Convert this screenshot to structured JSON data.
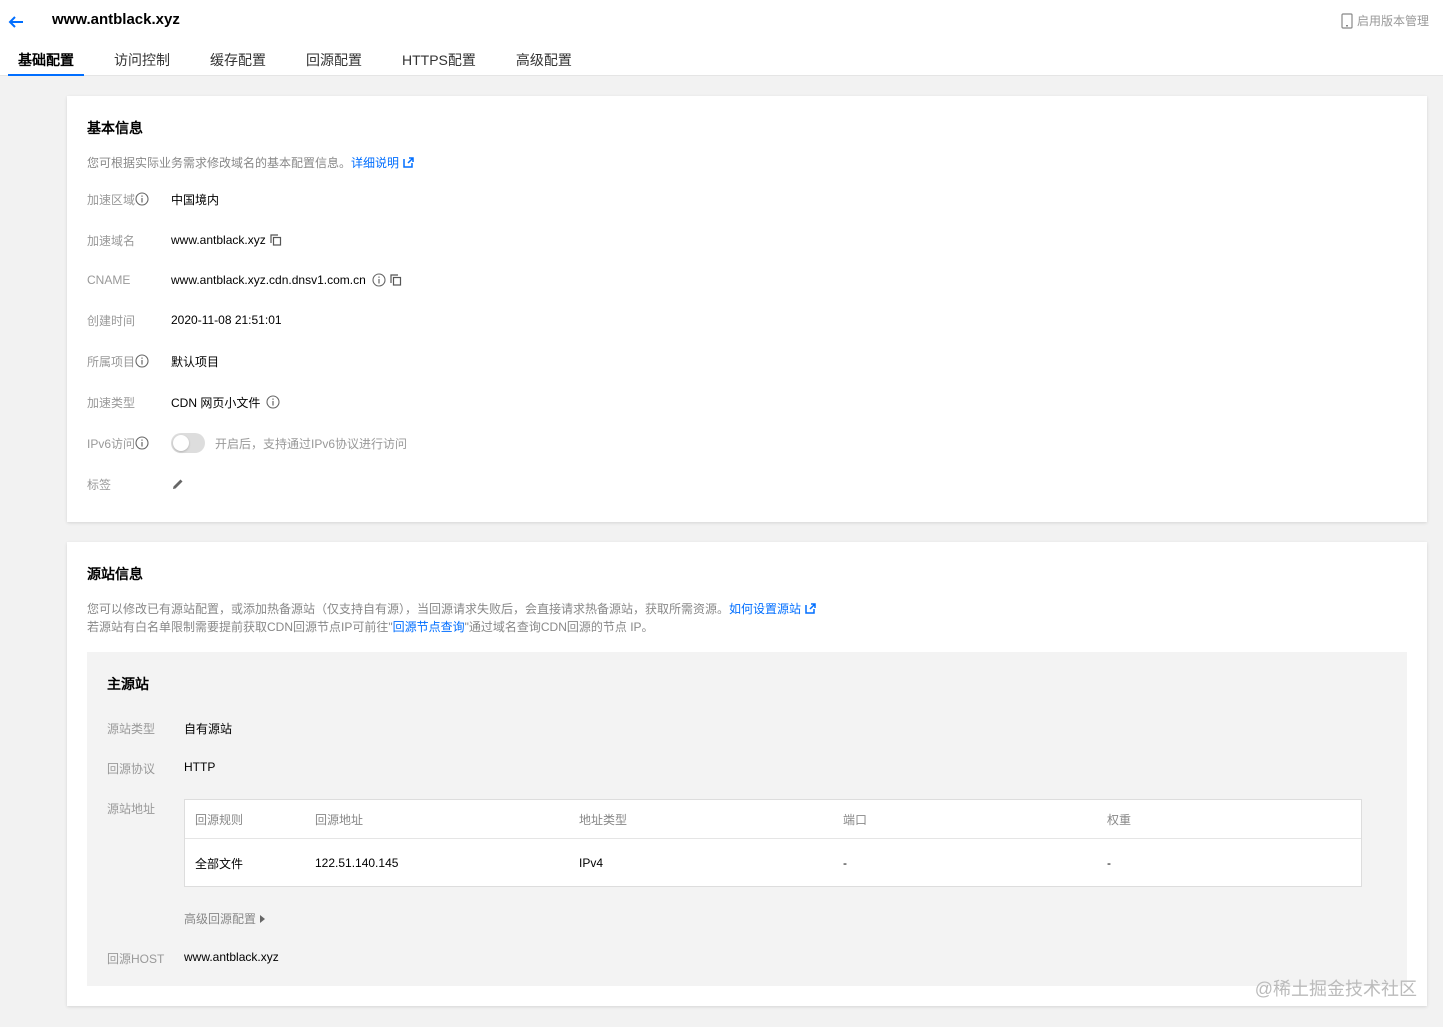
{
  "header": {
    "domain": "www.antblack.xyz",
    "version_management": "启用版本管理",
    "tabs": [
      {
        "label": "基础配置",
        "active": true
      },
      {
        "label": "访问控制"
      },
      {
        "label": "缓存配置"
      },
      {
        "label": "回源配置"
      },
      {
        "label": "HTTPS配置"
      },
      {
        "label": "高级配置"
      }
    ]
  },
  "basic": {
    "title": "基本信息",
    "desc": "您可根据实际业务需求修改域名的基本配置信息。",
    "desc_link": "详细说明",
    "rows": {
      "area": {
        "label": "加速区域",
        "value": "中国境内"
      },
      "domain": {
        "label": "加速域名",
        "value": "www.antblack.xyz"
      },
      "cname": {
        "label": "CNAME",
        "value": "www.antblack.xyz.cdn.dnsv1.com.cn"
      },
      "created": {
        "label": "创建时间",
        "value": "2020-11-08 21:51:01"
      },
      "project": {
        "label": "所属项目",
        "value": "默认项目"
      },
      "type": {
        "label": "加速类型",
        "value": "CDN 网页小文件"
      },
      "ipv6": {
        "label": "IPv6访问",
        "value": "开启后，支持通过IPv6协议进行访问"
      },
      "tags": {
        "label": "标签"
      }
    }
  },
  "origin": {
    "title": "源站信息",
    "desc1": "您可以修改已有源站配置，或添加热备源站（仅支持自有源），当回源请求失败后，会直接请求热备源站，获取所需资源。",
    "desc1_link": "如何设置源站",
    "desc2_pre": "若源站有白名单限制需要提前获取CDN回源节点IP可前往\"",
    "desc2_link": "回源节点查询",
    "desc2_post": "\"通过域名查询CDN回源的节点 IP。",
    "main": {
      "title": "主源站",
      "type_label": "源站类型",
      "type_value": "自有源站",
      "protocol_label": "回源协议",
      "protocol_value": "HTTP",
      "address_label": "源站地址",
      "table": {
        "headers": [
          "回源规则",
          "回源地址",
          "地址类型",
          "端口",
          "权重"
        ],
        "row": [
          "全部文件",
          "122.51.140.145",
          "IPv4",
          "-",
          "-"
        ]
      },
      "advanced": "高级回源配置",
      "host_label": "回源HOST",
      "host_value": "www.antblack.xyz"
    }
  },
  "watermark": "@稀土掘金技术社区",
  "colors": {
    "accent": "#006eff"
  }
}
